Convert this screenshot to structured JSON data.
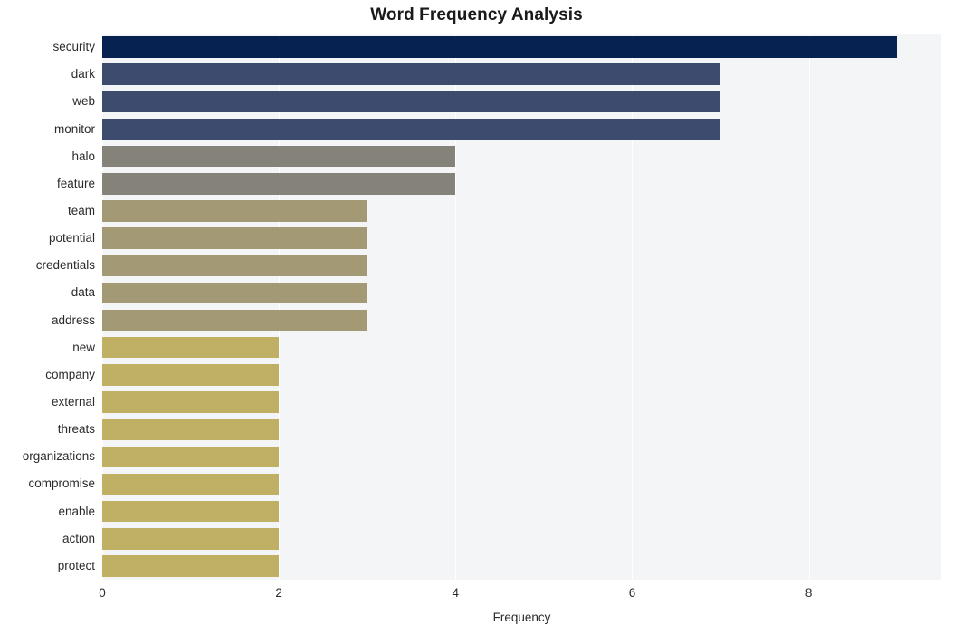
{
  "chart_data": {
    "type": "bar",
    "orientation": "horizontal",
    "title": "Word Frequency Analysis",
    "xlabel": "Frequency",
    "ylabel": "",
    "xlim": [
      0,
      9.5
    ],
    "xticks": [
      0,
      2,
      4,
      6,
      8
    ],
    "xtick_labels": [
      "0",
      "2",
      "4",
      "6",
      "8"
    ],
    "grid": true,
    "grid_axis": "x",
    "grid_color": "#ffffff",
    "plot_background": "#f4f5f6",
    "figure_background": "#ffffff",
    "legend": null,
    "categories": [
      "security",
      "dark",
      "web",
      "monitor",
      "halo",
      "feature",
      "team",
      "potential",
      "credentials",
      "data",
      "address",
      "new",
      "company",
      "external",
      "threats",
      "organizations",
      "compromise",
      "enable",
      "action",
      "protect"
    ],
    "values": [
      9,
      7,
      7,
      7,
      4,
      4,
      3,
      3,
      3,
      3,
      3,
      2,
      2,
      2,
      2,
      2,
      2,
      2,
      2,
      2
    ],
    "bar_colors": [
      "#062250",
      "#3d4b6e",
      "#3d4b6e",
      "#3d4b6e",
      "#85827a",
      "#85827a",
      "#a39a75",
      "#a39a75",
      "#a39a75",
      "#a39a75",
      "#a39a75",
      "#c0b063",
      "#c0b063",
      "#c0b063",
      "#c0b063",
      "#c0b063",
      "#c0b063",
      "#c0b063",
      "#c0b063",
      "#c0b063"
    ]
  }
}
